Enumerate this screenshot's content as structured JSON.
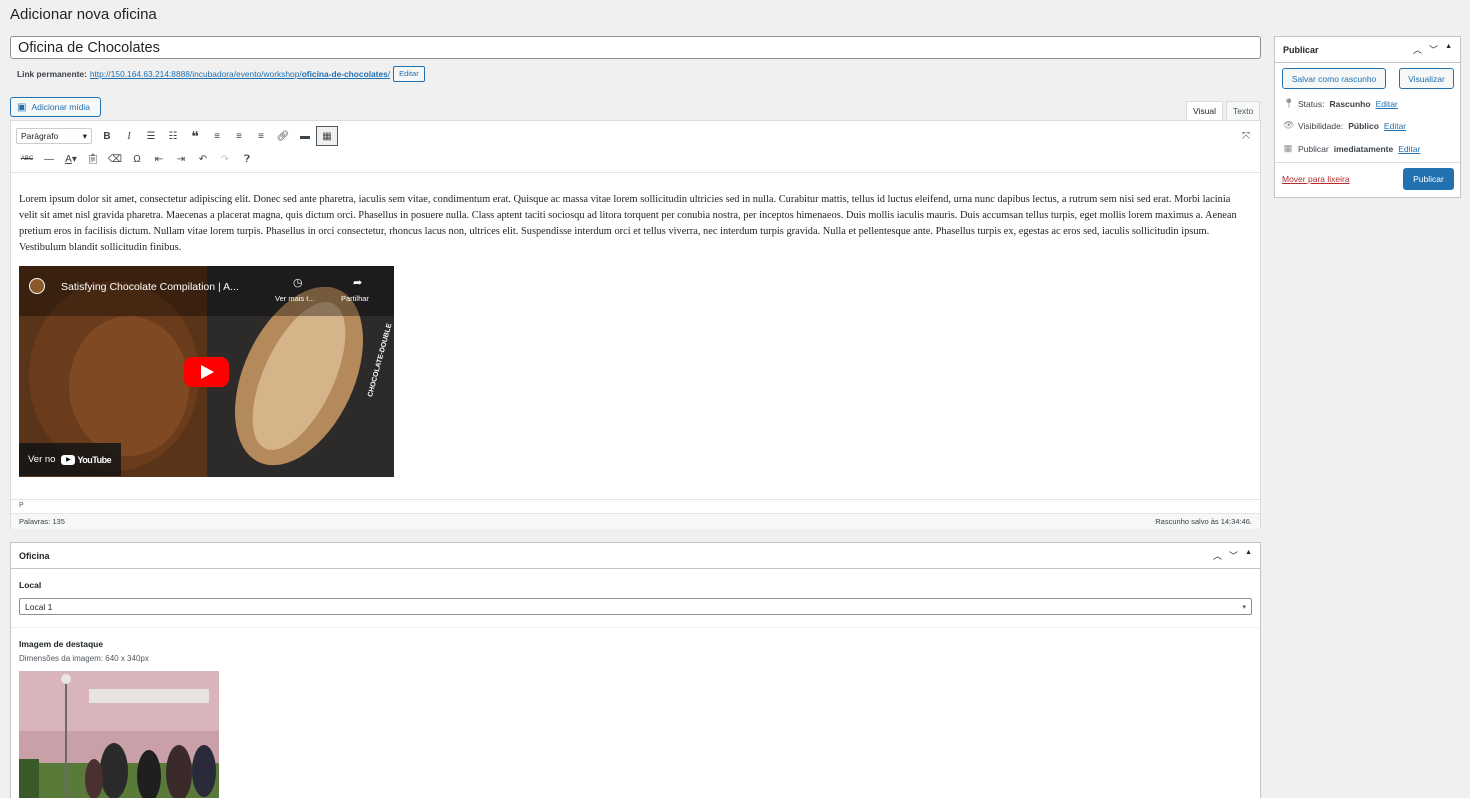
{
  "page_title": "Adicionar nova oficina",
  "post_title": "Oficina de Chocolates",
  "permalink": {
    "label": "Link permanente:",
    "url_base": "http://150.164.63.214:8888/incubadora/evento/workshop/",
    "url_slug": "oficina-de-chocolates",
    "url_trailing": "/",
    "edit_label": "Editar"
  },
  "editor": {
    "add_media_label": "Adicionar mídia",
    "tab_visual": "Visual",
    "tab_text": "Texto",
    "format_select": "Parágrafo",
    "content_paragraph": "Lorem ipsum dolor sit amet, consectetur adipiscing elit. Donec sed ante pharetra, iaculis sem vitae, condimentum erat. Quisque ac massa vitae lorem sollicitudin ultricies sed in nulla. Curabitur mattis, tellus id luctus eleifend, urna nunc dapibus lectus, a rutrum sem nisi sed erat. Morbi lacinia velit sit amet nisl gravida pharetra. Maecenas a placerat magna, quis dictum orci. Phasellus in posuere nulla. Class aptent taciti sociosqu ad litora torquent per conubia nostra, per inceptos himenaeos. Duis mollis iaculis mauris. Duis accumsan tellus turpis, eget mollis lorem maximus a. Aenean pretium eros in facilisis dictum. Nullam vitae lorem turpis. Phasellus in orci consectetur, rhoncus lacus non, ultrices elit. Suspendisse interdum orci et tellus viverra, nec interdum turpis gravida. Nulla et pellentesque ante. Phasellus turpis ex, egestas ac eros sed, iaculis sollicitudin ipsum. Vestibulum blandit sollicitudin finibus.",
    "video": {
      "title": "Satisfying Chocolate Compilation | A...",
      "watch_later": "Ver mais t...",
      "share": "Partilhar",
      "watch_on": "Ver no",
      "youtube": "YouTube",
      "side_text": "CHOCOLATE-DOUBLE"
    },
    "path": "P",
    "word_count": "Palavras: 135",
    "draft_saved": "Rascunho salvo às 14:34:46."
  },
  "publish_box": {
    "title": "Publicar",
    "save_draft": "Salvar como rascunho",
    "preview": "Visualizar",
    "status_label": "Status:",
    "status_value": "Rascunho",
    "visibility_label": "Visibilidade:",
    "visibility_value": "Público",
    "publish_label": "Publicar",
    "publish_value": "imediatamente",
    "edit": "Editar",
    "trash": "Mover para lixeira",
    "publish_button": "Publicar"
  },
  "oficina_box": {
    "title": "Oficina",
    "local_label": "Local",
    "local_value": "Local 1",
    "image_label": "Imagem de destaque",
    "image_dims": "Dimensões da imagem: 640 x 340px"
  },
  "colors": {
    "accent": "#2271b1",
    "trash": "#b32d2e",
    "background": "#f0f0f1"
  }
}
